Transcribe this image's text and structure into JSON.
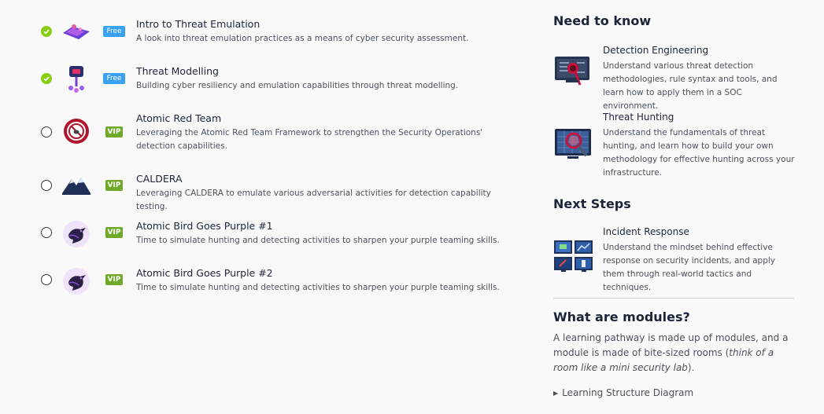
{
  "rooms": [
    {
      "title": "Intro to Threat Emulation",
      "description": "A look into threat emulation practices as a means of cyber security assessment.",
      "badge": "Free",
      "status": "completed"
    },
    {
      "title": "Threat Modelling",
      "description": "Building cyber resiliency and emulation capabilities through threat modelling.",
      "badge": "Free",
      "status": "completed"
    },
    {
      "title": "Atomic Red Team",
      "description": "Leveraging the Atomic Red Team Framework to strengthen the Security Operations' detection capabilities.",
      "badge": "VIP",
      "status": "not-started"
    },
    {
      "title": "CALDERA",
      "description": "Leveraging CALDERA to emulate various adversarial activities for detection capability testing.",
      "badge": "VIP",
      "status": "not-started"
    },
    {
      "title": "Atomic Bird Goes Purple #1",
      "description": "Time to simulate hunting and detecting activities to sharpen your purple teaming skills.",
      "badge": "VIP",
      "status": "not-started"
    },
    {
      "title": "Atomic Bird Goes Purple #2",
      "description": "Time to simulate hunting and detecting activities to sharpen your purple teaming skills.",
      "badge": "VIP",
      "status": "not-started"
    }
  ],
  "sidebar": {
    "need_to_know": {
      "heading": "Need to know",
      "items": [
        {
          "title": "Detection Engineering",
          "description": "Understand various threat detection methodologies, rule syntax and tools, and learn how to apply them in a SOC environment."
        },
        {
          "title": "Threat Hunting",
          "description": "Understand the fundamentals of threat hunting, and learn how to build your own methodology for effective hunting across your infrastructure."
        }
      ]
    },
    "next_steps": {
      "heading": "Next Steps",
      "items": [
        {
          "title": "Incident Response",
          "description": "Understand the mindset behind effective response on security incidents, and apply them through real-world tactics and techniques."
        }
      ]
    },
    "modules": {
      "heading": "What are modules?",
      "text_before": "A learning pathway is made up of modules, and a module is made of bite-sized rooms (",
      "text_italic": "think of a room like a mini security lab",
      "text_after": ").",
      "details_label": "Learning Structure Diagram"
    }
  },
  "colors": {
    "completed": "#88cc14",
    "free_badge": "#3aa1f2",
    "vip_badge": "#70a92a",
    "text_dark": "#1c2538",
    "text_muted": "#4b525d"
  }
}
